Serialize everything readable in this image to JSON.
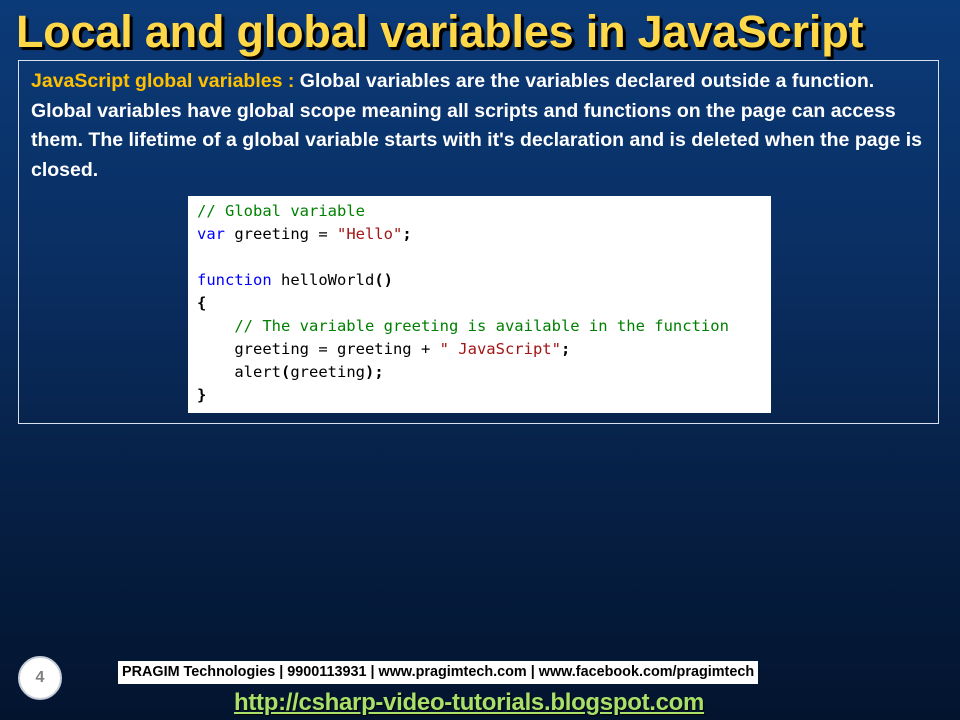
{
  "slide": {
    "title": "Local and global variables in JavaScript",
    "description_lead": "JavaScript global variables : ",
    "description_body": "Global variables are the variables declared outside a function. Global variables have global scope meaning all scripts and functions on the page can access them. The lifetime of a global variable starts with it's declaration and is deleted when the page is closed.",
    "page_number": "4"
  },
  "code": {
    "comment_global": "// Global variable",
    "kw_var": "var",
    "decl_greeting": " greeting = ",
    "str_hello": "\"Hello\"",
    "semicolon": ";",
    "kw_function": "function",
    "fn_signature": " helloWorld",
    "parens": "()",
    "brace_open": "{",
    "indent": "    ",
    "comment_available": "// The variable greeting is available in the function",
    "concat_expr": "greeting = greeting + ",
    "str_javascript": "\" JavaScript\"",
    "alert_call": "alert",
    "paren_open": "(",
    "alert_arg": "greeting",
    "paren_close": ")",
    "brace_close": "}"
  },
  "footer": {
    "contact": "PRAGIM Technologies | 9900113931 | www.pragimtech.com | www.facebook.com/pragimtech",
    "link": "http://csharp-video-tutorials.blogspot.com"
  },
  "colors": {
    "title": "#ffd84a",
    "lead": "#ffc000",
    "background_top": "#0b3a78",
    "background_bottom": "#03142e",
    "code_comment": "#008000",
    "code_keyword": "#0000ff",
    "code_string": "#a31515",
    "footer_link": "#a8e06a"
  }
}
